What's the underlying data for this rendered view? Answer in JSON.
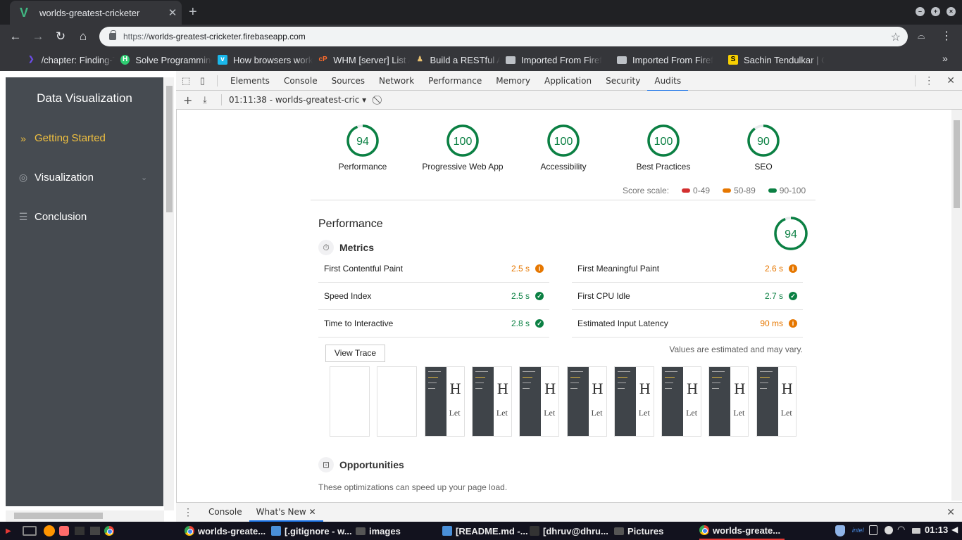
{
  "browser": {
    "tab_title": "worlds-greatest-cricketer",
    "tab_icon": "vue-logo-icon",
    "url_scheme": "https://",
    "url_host": "worlds-greatest-cricketer.firebaseapp.com",
    "bookmarks": [
      {
        "label": "/chapter: Finding-Th",
        "icon": "purple-logo-icon",
        "color": "#6b4ce6"
      },
      {
        "label": "Solve Programming",
        "icon": "hackerearth-icon",
        "color": "#2ecc71"
      },
      {
        "label": "How browsers work",
        "icon": "vimeo-icon",
        "color": "#1ab7ea"
      },
      {
        "label": "WHM [server] List A",
        "icon": "cpanel-icon",
        "color": "#ff6c2c"
      },
      {
        "label": "Build a RESTful AF",
        "icon": "scotch-icon",
        "color": "#e8c070"
      },
      {
        "label": "Imported From Firef",
        "icon": "folder-icon",
        "color": "#bdc1c6"
      },
      {
        "label": "Imported From Firef",
        "icon": "folder-icon",
        "color": "#bdc1c6"
      },
      {
        "label": "Sachin Tendulkar | C",
        "icon": "s-logo-icon",
        "color": "#f7d002"
      }
    ],
    "more_bookmarks": "»"
  },
  "sidebar": {
    "brand": "Data Visualization",
    "items": [
      {
        "label": "Getting Started",
        "icon": "double-chevron-icon",
        "active": true
      },
      {
        "label": "Visualization",
        "icon": "eye-icon",
        "has_submenu": true
      },
      {
        "label": "Conclusion",
        "icon": "document-icon"
      }
    ]
  },
  "devtools": {
    "tabs": [
      "Elements",
      "Console",
      "Sources",
      "Network",
      "Performance",
      "Memory",
      "Application",
      "Security",
      "Audits"
    ],
    "active_tab": "Audits",
    "report_selector": "01:11:38 - worlds-greatest-cric",
    "drawer_tabs": [
      "Console",
      "What's New"
    ],
    "drawer_active": "What's New"
  },
  "audit": {
    "categories": [
      {
        "label": "Performance",
        "score": 94
      },
      {
        "label": "Progressive Web App",
        "score": 100
      },
      {
        "label": "Accessibility",
        "score": 100
      },
      {
        "label": "Best Practices",
        "score": 100
      },
      {
        "label": "SEO",
        "score": 90
      }
    ],
    "score_scale_label": "Score scale:",
    "scale": [
      {
        "range": "0-49",
        "color": "#d32f2f"
      },
      {
        "range": "50-89",
        "color": "#e67700"
      },
      {
        "range": "90-100",
        "color": "#0b8043"
      }
    ],
    "performance": {
      "title": "Performance",
      "score": 94,
      "metrics_heading": "Metrics",
      "metrics": [
        {
          "name": "First Contentful Paint",
          "value": "2.5 s",
          "status": "average"
        },
        {
          "name": "First Meaningful Paint",
          "value": "2.6 s",
          "status": "average"
        },
        {
          "name": "Speed Index",
          "value": "2.5 s",
          "status": "pass"
        },
        {
          "name": "First CPU Idle",
          "value": "2.7 s",
          "status": "pass"
        },
        {
          "name": "Time to Interactive",
          "value": "2.8 s",
          "status": "pass"
        },
        {
          "name": "Estimated Input Latency",
          "value": "90 ms",
          "status": "average"
        }
      ],
      "view_trace": "View Trace",
      "estimated_note": "Values are estimated and may vary.",
      "filmstrip_frames": 10,
      "filmstrip_blank_frames": 2,
      "frame_heading_glyph": "H",
      "frame_text": "Let"
    },
    "opportunities": {
      "heading": "Opportunities",
      "description": "These optimizations can speed up your page load."
    }
  },
  "taskbar": {
    "windows": [
      {
        "label": "worlds-greate...",
        "icon": "chrome-icon"
      },
      {
        "label": "[.gitignore - w...",
        "icon": "vscode-icon"
      },
      {
        "label": "images",
        "icon": "folder-icon"
      },
      {
        "label": "[README.md -...",
        "icon": "vscode-icon"
      },
      {
        "label": "[dhruv@dhru...",
        "icon": "terminal-icon"
      },
      {
        "label": "Pictures",
        "icon": "folder-icon"
      },
      {
        "label": "worlds-greate...",
        "icon": "chrome-icon",
        "active": true
      }
    ],
    "clock": "01:13"
  }
}
